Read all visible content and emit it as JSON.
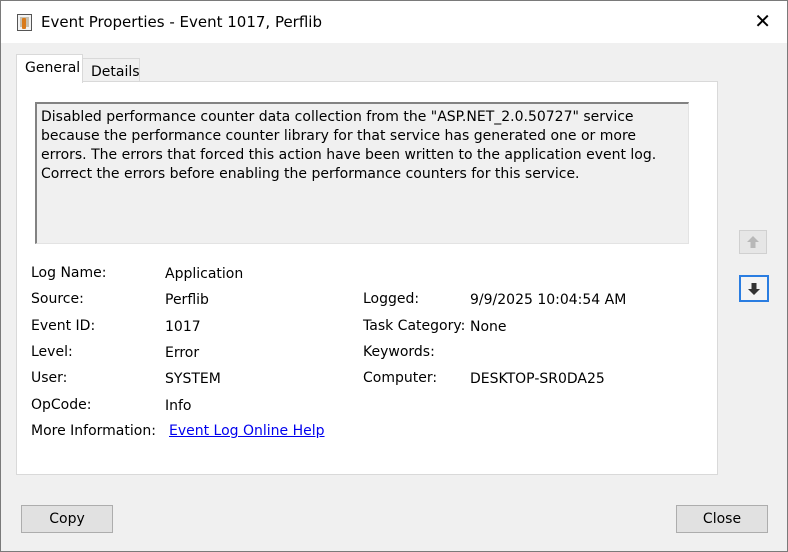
{
  "window": {
    "title": "Event Properties - Event 1017, Perflib",
    "close_glyph": "✕"
  },
  "tabs": [
    {
      "label": "General",
      "selected": true
    },
    {
      "label": "Details",
      "selected": false
    }
  ],
  "description": "Disabled performance counter data collection from the \"ASP.NET_2.0.50727\" service because the performance counter library for that service has generated one or more errors. The errors that forced this action have been written to the application event log. Correct the errors before enabling the performance counters for this service.",
  "fields": {
    "log_name": {
      "label": "Log Name:",
      "value": "Application"
    },
    "source": {
      "label": "Source:",
      "value": "Perflib"
    },
    "event_id": {
      "label": "Event ID:",
      "value": "1017"
    },
    "level": {
      "label": "Level:",
      "value": "Error"
    },
    "user": {
      "label": "User:",
      "value": "SYSTEM"
    },
    "opcode": {
      "label": "OpCode:",
      "value": "Info"
    },
    "more_info": {
      "label": "More Information:",
      "link": "Event Log Online Help"
    },
    "logged": {
      "label": "Logged:",
      "value": "9/9/2025 10:04:54 AM"
    },
    "task_category": {
      "label": "Task Category:",
      "value": "None"
    },
    "keywords": {
      "label": "Keywords:",
      "value": ""
    },
    "computer": {
      "label": "Computer:",
      "value": "DESKTOP-SR0DA25"
    }
  },
  "nav": {
    "up_icon": "arrow-up-icon",
    "down_icon": "arrow-down-icon"
  },
  "buttons": {
    "copy": "Copy",
    "close": "Close"
  },
  "colors": {
    "link": "#0000ee",
    "focus": "#2a7de1"
  }
}
